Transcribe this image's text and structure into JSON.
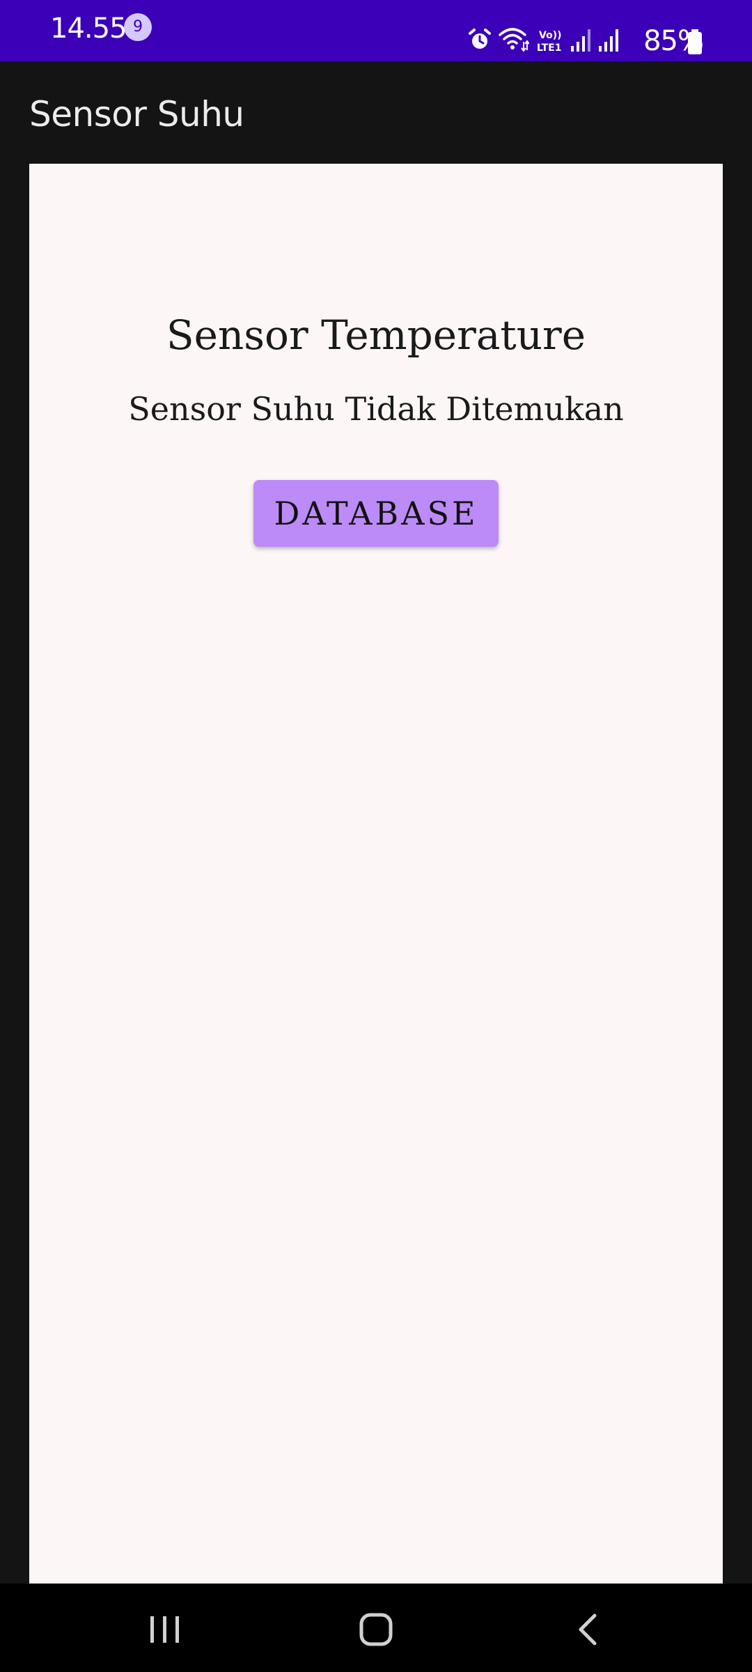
{
  "status_bar": {
    "time": "14.55",
    "notification_count": "9",
    "battery_percent": "85%",
    "icons": [
      "alarm-icon",
      "wifi-icon",
      "volte-icon",
      "signal-icon",
      "signal-icon",
      "battery-icon"
    ],
    "background_color": "#3b00b7"
  },
  "app_bar": {
    "title": "Sensor Suhu"
  },
  "main": {
    "heading": "Sensor Temperature",
    "status": "Sensor Suhu Tidak Ditemukan",
    "database_button": "DATABASE",
    "button_color": "#bc8bf7"
  },
  "nav_bar": {
    "items": [
      "recent-apps-icon",
      "home-icon",
      "back-icon"
    ]
  }
}
